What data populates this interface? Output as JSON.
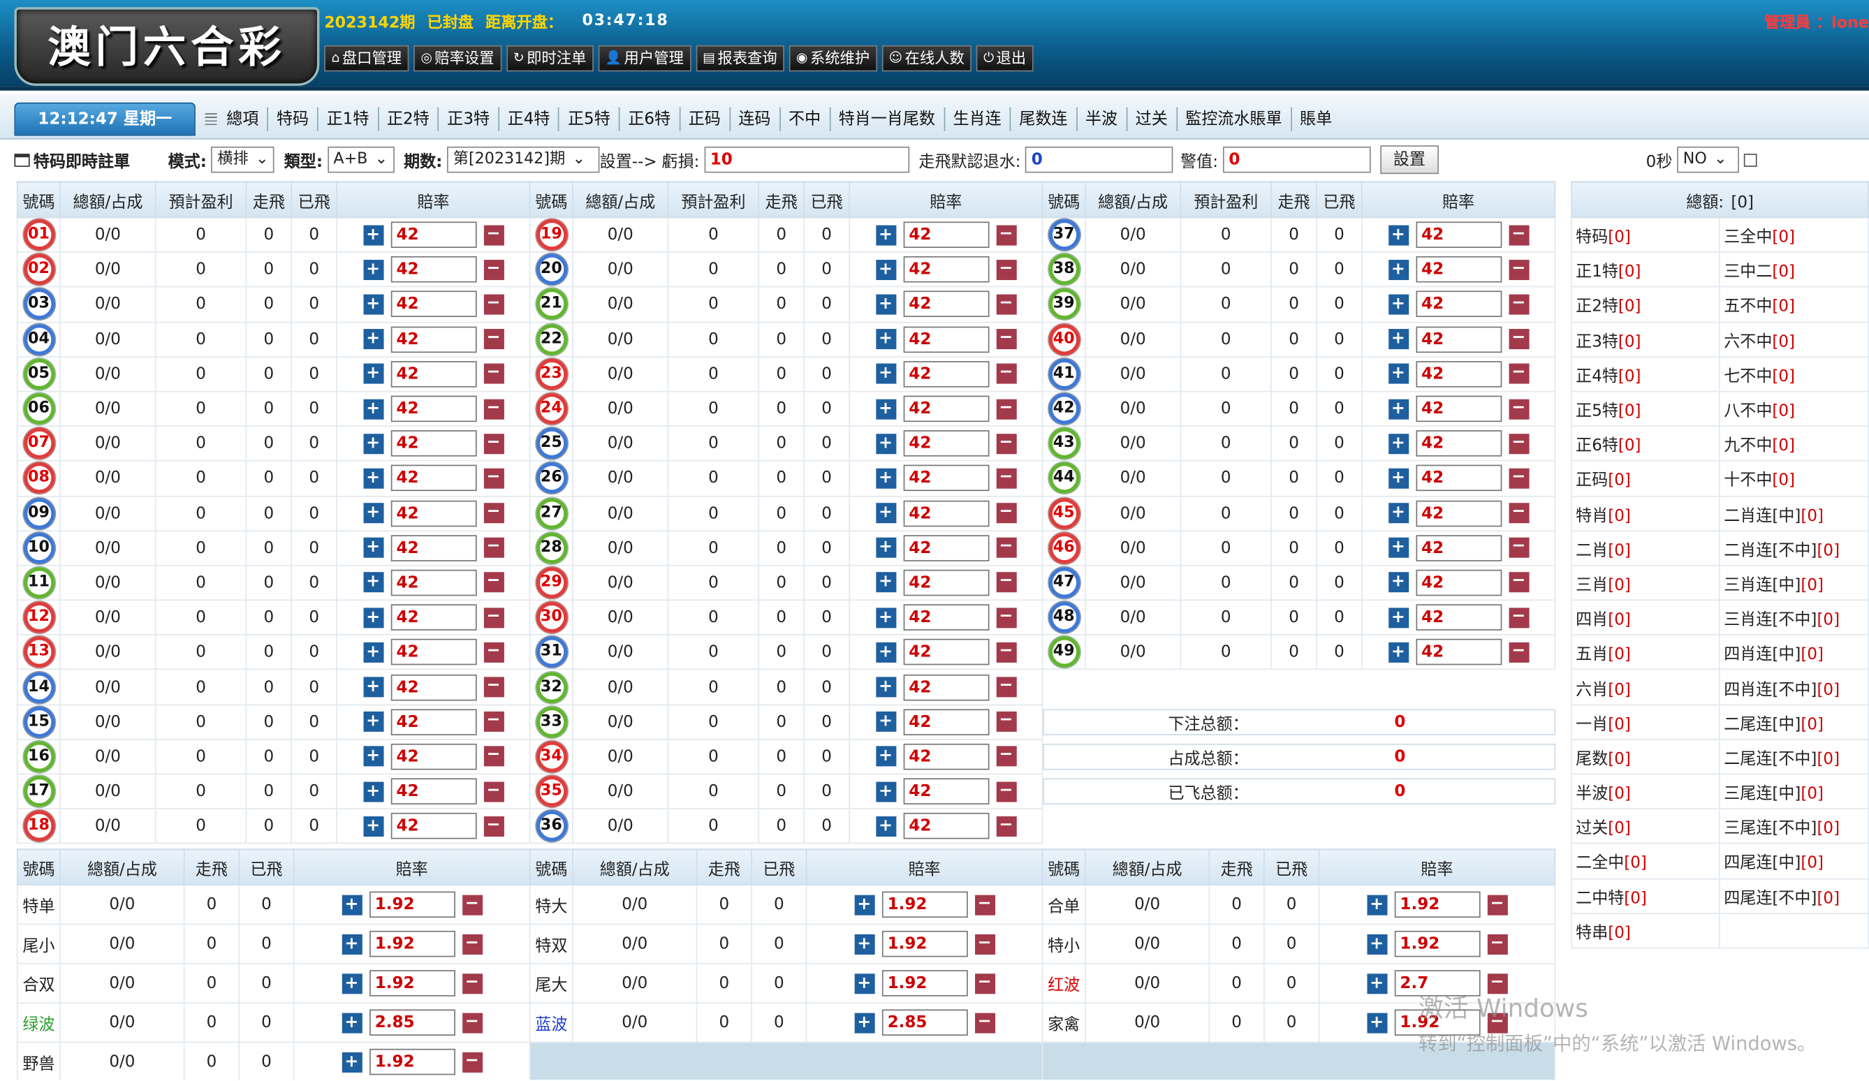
{
  "header": {
    "logo": "澳门六合彩",
    "issue": "2023142期",
    "status": "已封盘",
    "countdown_label": "距离开盘：",
    "countdown": "03:47:18",
    "admin": "管理員 ：lone",
    "menu": [
      {
        "icon": "home-icon",
        "glyph": "⌂",
        "label": "盘口管理"
      },
      {
        "icon": "target-icon",
        "glyph": "◎",
        "label": "赔率设置"
      },
      {
        "icon": "refresh-icon",
        "glyph": "↻",
        "label": "即时注单"
      },
      {
        "icon": "user-icon",
        "glyph": "👤",
        "label": "用户管理"
      },
      {
        "icon": "report-icon",
        "glyph": "▤",
        "label": "报表查询"
      },
      {
        "icon": "broadcast-icon",
        "glyph": "◉",
        "label": "系统维护"
      },
      {
        "icon": "smile-icon",
        "glyph": "☺",
        "label": "在线人数"
      },
      {
        "icon": "power-icon",
        "glyph": "⏻",
        "label": "退出"
      }
    ]
  },
  "clock": "12:12:47 星期一",
  "tabs": [
    "總項",
    "特码",
    "正1特",
    "正2特",
    "正3特",
    "正4特",
    "正5特",
    "正6特",
    "正码",
    "连码",
    "不中",
    "特肖一肖尾数",
    "生肖连",
    "尾数连",
    "半波",
    "过关",
    "監控流水賬單",
    "賬单"
  ],
  "controls": {
    "title": "特码即時註單",
    "mode_label": "模式:",
    "mode": "横排",
    "type_label": "類型:",
    "type": "A+B",
    "period_label": "期数:",
    "period": "第[2023142]期",
    "settings_label": "設置-->",
    "loss_label": "虧損:",
    "loss": "10",
    "rebate_label": "走飛默認退水:",
    "rebate": "0",
    "alert_label": "警值:",
    "alert": "0",
    "set_button": "設置",
    "refresh_label": "0秒",
    "refresh_select": "NO"
  },
  "table_headers": [
    "號碼",
    "總額/占成",
    "預計盈利",
    "走飛",
    "已飛",
    "賠率"
  ],
  "sub_headers": [
    "號碼",
    "總額/占成",
    "走飛",
    "已飛",
    "賠率"
  ],
  "numbers": [
    {
      "n": "01",
      "c": "red"
    },
    {
      "n": "02",
      "c": "red"
    },
    {
      "n": "03",
      "c": "blue"
    },
    {
      "n": "04",
      "c": "blue"
    },
    {
      "n": "05",
      "c": "green"
    },
    {
      "n": "06",
      "c": "green"
    },
    {
      "n": "07",
      "c": "red"
    },
    {
      "n": "08",
      "c": "red"
    },
    {
      "n": "09",
      "c": "blue"
    },
    {
      "n": "10",
      "c": "blue"
    },
    {
      "n": "11",
      "c": "green"
    },
    {
      "n": "12",
      "c": "red"
    },
    {
      "n": "13",
      "c": "red"
    },
    {
      "n": "14",
      "c": "blue"
    },
    {
      "n": "15",
      "c": "blue"
    },
    {
      "n": "16",
      "c": "green"
    },
    {
      "n": "17",
      "c": "green"
    },
    {
      "n": "18",
      "c": "red"
    },
    {
      "n": "19",
      "c": "red"
    },
    {
      "n": "20",
      "c": "blue"
    },
    {
      "n": "21",
      "c": "green"
    },
    {
      "n": "22",
      "c": "green"
    },
    {
      "n": "23",
      "c": "red"
    },
    {
      "n": "24",
      "c": "red"
    },
    {
      "n": "25",
      "c": "blue"
    },
    {
      "n": "26",
      "c": "blue"
    },
    {
      "n": "27",
      "c": "green"
    },
    {
      "n": "28",
      "c": "green"
    },
    {
      "n": "29",
      "c": "red"
    },
    {
      "n": "30",
      "c": "red"
    },
    {
      "n": "31",
      "c": "blue"
    },
    {
      "n": "32",
      "c": "green"
    },
    {
      "n": "33",
      "c": "green"
    },
    {
      "n": "34",
      "c": "red"
    },
    {
      "n": "35",
      "c": "red"
    },
    {
      "n": "36",
      "c": "blue"
    },
    {
      "n": "37",
      "c": "blue"
    },
    {
      "n": "38",
      "c": "green"
    },
    {
      "n": "39",
      "c": "green"
    },
    {
      "n": "40",
      "c": "red"
    },
    {
      "n": "41",
      "c": "blue"
    },
    {
      "n": "42",
      "c": "blue"
    },
    {
      "n": "43",
      "c": "green"
    },
    {
      "n": "44",
      "c": "green"
    },
    {
      "n": "45",
      "c": "red"
    },
    {
      "n": "46",
      "c": "red"
    },
    {
      "n": "47",
      "c": "blue"
    },
    {
      "n": "48",
      "c": "blue"
    },
    {
      "n": "49",
      "c": "green"
    }
  ],
  "number_row": {
    "total": "0/0",
    "profit": "0",
    "walk": "0",
    "flown": "0",
    "odds": "42"
  },
  "summary": [
    {
      "label": "下注总额：",
      "value": "0"
    },
    {
      "label": "占成总额：",
      "value": "0"
    },
    {
      "label": "已飞总额：",
      "value": "0"
    }
  ],
  "extras": [
    [
      {
        "name": "特单",
        "cls": "",
        "odds": "1.92"
      },
      {
        "name": "特大",
        "cls": "",
        "odds": "1.92"
      },
      {
        "name": "合单",
        "cls": "",
        "odds": "1.92"
      }
    ],
    [
      {
        "name": "尾小",
        "cls": "",
        "odds": "1.92"
      },
      {
        "name": "特双",
        "cls": "",
        "odds": "1.92"
      },
      {
        "name": "特小",
        "cls": "",
        "odds": "1.92"
      }
    ],
    [
      {
        "name": "合双",
        "cls": "",
        "odds": "1.92"
      },
      {
        "name": "尾大",
        "cls": "",
        "odds": "1.92"
      },
      {
        "name": "红波",
        "cls": "red",
        "odds": "2.7"
      }
    ],
    [
      {
        "name": "绿波",
        "cls": "grn",
        "odds": "2.85"
      },
      {
        "name": "蓝波",
        "cls": "blu",
        "odds": "2.85"
      },
      {
        "name": "家禽",
        "cls": "",
        "odds": "1.92"
      }
    ],
    [
      {
        "name": "野兽",
        "cls": "",
        "odds": "1.92"
      }
    ]
  ],
  "extra_row": {
    "total": "0/0",
    "walk": "0",
    "flown": "0"
  },
  "side": {
    "header_label": "總額:",
    "header_value": "[0]",
    "rows": [
      [
        "特码",
        "[0]",
        "三全中",
        "[0]"
      ],
      [
        "正1特",
        "[0]",
        "三中二",
        "[0]"
      ],
      [
        "正2特",
        "[0]",
        "五不中",
        "[0]"
      ],
      [
        "正3特",
        "[0]",
        "六不中",
        "[0]"
      ],
      [
        "正4特",
        "[0]",
        "七不中",
        "[0]"
      ],
      [
        "正5特",
        "[0]",
        "八不中",
        "[0]"
      ],
      [
        "正6特",
        "[0]",
        "九不中",
        "[0]"
      ],
      [
        "正码",
        "[0]",
        "十不中",
        "[0]"
      ],
      [
        "特肖",
        "[0]",
        "二肖连[中]",
        "[0]"
      ],
      [
        "二肖",
        "[0]",
        "二肖连[不中]",
        "[0]"
      ],
      [
        "三肖",
        "[0]",
        "三肖连[中]",
        "[0]"
      ],
      [
        "四肖",
        "[0]",
        "三肖连[不中]",
        "[0]"
      ],
      [
        "五肖",
        "[0]",
        "四肖连[中]",
        "[0]"
      ],
      [
        "六肖",
        "[0]",
        "四肖连[不中]",
        "[0]"
      ],
      [
        "一肖",
        "[0]",
        "二尾连[中]",
        "[0]"
      ],
      [
        "尾数",
        "[0]",
        "二尾连[不中]",
        "[0]"
      ],
      [
        "半波",
        "[0]",
        "三尾连[中]",
        "[0]"
      ],
      [
        "过关",
        "[0]",
        "三尾连[不中]",
        "[0]"
      ],
      [
        "二全中",
        "[0]",
        "四尾连[中]",
        "[0]"
      ],
      [
        "二中特",
        "[0]",
        "四尾连[不中]",
        "[0]"
      ],
      [
        "特串",
        "[0]",
        "",
        ""
      ]
    ]
  },
  "watermark": {
    "line1": "激活 Windows",
    "line2": "转到“控制面板”中的“系统”以激活 Windows。"
  }
}
